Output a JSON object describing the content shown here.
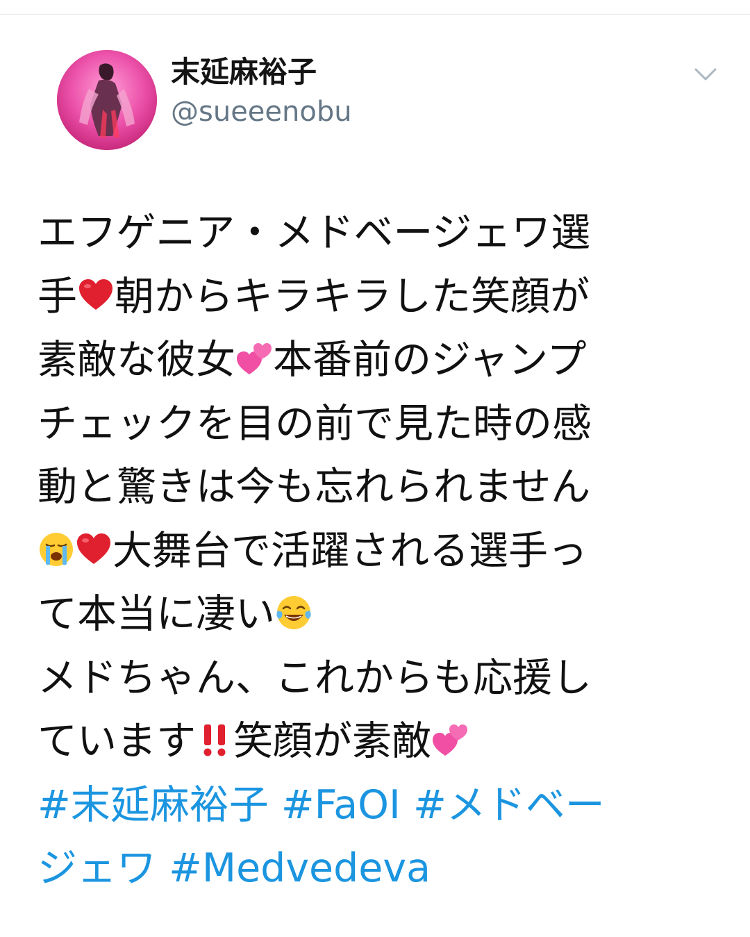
{
  "tweet": {
    "display_name": "末延麻裕子",
    "handle": "@sueeenobu",
    "lines": {
      "l1": "エフゲニア・メドベージェワ選",
      "l2a": "手",
      "l2b": "朝からキラキラした笑顔が",
      "l3a": "素敵な彼女",
      "l3b": "本番前のジャンプ",
      "l4": "チェックを目の前で見た時の感",
      "l5": "動と驚きは今も忘れられません",
      "l6": "大舞台で活躍される選手っ",
      "l7": "て本当に凄い",
      "l8": "メドちゃん、これからも応援し",
      "l9a": "います",
      "l9pre": "て",
      "l9b": "笑顔が素敵"
    },
    "hashtags": {
      "h1": "#末延麻裕子",
      "h2": "#FaOI",
      "h3a": "#メドベー",
      "h3b": "ジェワ",
      "h4": "#Medvedeva"
    },
    "emojis": [
      "red-heart",
      "two-hearts",
      "loudly-crying-face",
      "red-heart",
      "face-with-tears-of-joy",
      "double-exclamation",
      "two-hearts"
    ]
  },
  "colors": {
    "hashtag": "#1b95e0",
    "handle": "#657786",
    "text": "#111111",
    "heart": "#e0202f",
    "pink_heart": "#f04fa3"
  }
}
